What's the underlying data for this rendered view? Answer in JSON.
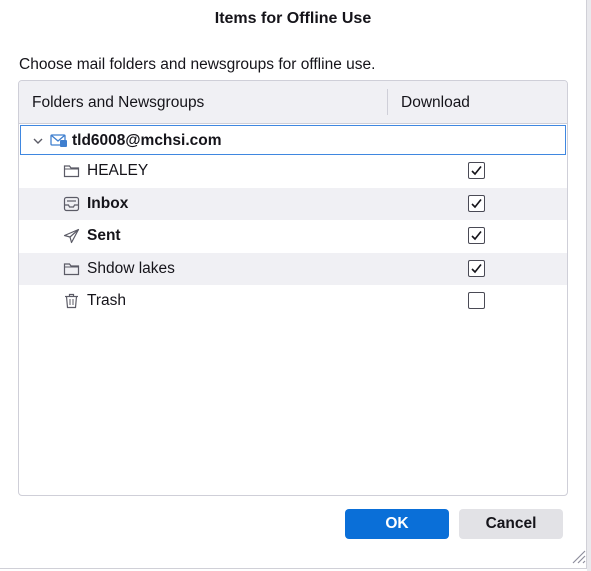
{
  "dialog": {
    "title": "Items for Offline Use",
    "description": "Choose mail folders and newsgroups for offline use."
  },
  "tree": {
    "columns": {
      "name": "Folders and Newsgroups",
      "download": "Download"
    },
    "account": {
      "label": "tld6008@mchsi.com",
      "expanded": true,
      "icon": "mail-account-icon"
    },
    "folders": [
      {
        "label": "HEALEY",
        "icon": "folder-icon",
        "checked": true,
        "bold": false
      },
      {
        "label": "Inbox",
        "icon": "inbox-icon",
        "checked": true,
        "bold": true
      },
      {
        "label": "Sent",
        "icon": "sent-icon",
        "checked": true,
        "bold": true
      },
      {
        "label": "Shdow lakes",
        "icon": "folder-icon",
        "checked": true,
        "bold": false
      },
      {
        "label": "Trash",
        "icon": "trash-icon",
        "checked": false,
        "bold": false
      }
    ]
  },
  "buttons": {
    "ok": "OK",
    "cancel": "Cancel"
  },
  "colors": {
    "accent": "#0a6fd8",
    "selection_border": "#3f87e0",
    "row_alt": "#f0f0f4"
  }
}
